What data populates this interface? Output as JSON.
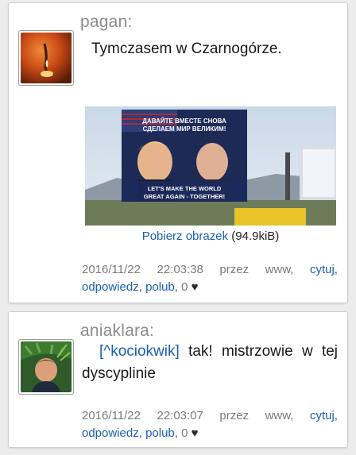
{
  "posts": [
    {
      "username": "pagan:",
      "avatar_icon": "candle-avatar",
      "text": "Tymczasem w Czarnogórze.",
      "image": {
        "banner_line1": "ДАВАЙТЕ ВМЕСТЕ СНОВА",
        "banner_line2": "СДЕЛАЕМ МИР ВЕЛИКИМ!",
        "banner_line3": "LET'S MAKE THE WORLD",
        "banner_line4": "GREAT AGAIN - TOGETHER!"
      },
      "download_link": "Pobierz obrazek",
      "download_size": "(94.9kiB)",
      "date": "2016/11/22",
      "time": "22:03:38",
      "via": "przez",
      "source": "www,",
      "quote": "cytuj,",
      "reply": "odpowiedz,",
      "like": "polub,",
      "likes": "0"
    },
    {
      "username": "aniaklara:",
      "avatar_icon": "person-avatar",
      "mention": "[^kociokwik]",
      "text": "tak! mistrzowie w tej dyscyplinie",
      "date": "2016/11/22",
      "time": "22:03:07",
      "via": "przez",
      "source": "www,",
      "quote": "cytuj,",
      "reply": "odpowiedz,",
      "like": "polub,",
      "likes": "0"
    }
  ],
  "colors": {
    "link": "#1a5fb4",
    "meta": "#7a7a7a",
    "username": "#8c8c8c"
  }
}
